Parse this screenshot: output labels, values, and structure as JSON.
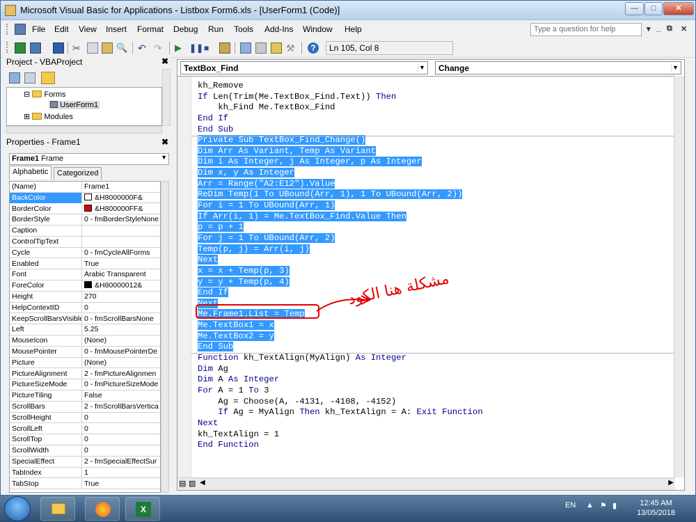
{
  "window": {
    "title": "Microsoft Visual Basic for Applications - Listbox Form6.xls - [UserForm1 (Code)]"
  },
  "menu": {
    "items": [
      "File",
      "Edit",
      "View",
      "Insert",
      "Format",
      "Debug",
      "Run",
      "Tools",
      "Add-Ins",
      "Window",
      "Help"
    ],
    "help_placeholder": "Type a question for help"
  },
  "toolbar": {
    "position": "Ln 105, Col 8"
  },
  "project": {
    "title": "Project - VBAProject",
    "tree": [
      "Forms",
      "UserForm1",
      "Modules"
    ]
  },
  "properties": {
    "title": "Properties - Frame1",
    "object": "Frame1",
    "object_type": "Frame",
    "tabs": [
      "Alphabetic",
      "Categorized"
    ],
    "rows": [
      {
        "name": "(Name)",
        "value": "Frame1"
      },
      {
        "name": "BackColor",
        "value": "&H8000000F&",
        "swatch": "#ffffff"
      },
      {
        "name": "BorderColor",
        "value": "&H800000FF&",
        "swatch": "#e00000"
      },
      {
        "name": "BorderStyle",
        "value": "0 - fmBorderStyleNone"
      },
      {
        "name": "Caption",
        "value": ""
      },
      {
        "name": "ControlTipText",
        "value": ""
      },
      {
        "name": "Cycle",
        "value": "0 - fmCycleAllForms"
      },
      {
        "name": "Enabled",
        "value": "True"
      },
      {
        "name": "Font",
        "value": "Arabic Transparent"
      },
      {
        "name": "ForeColor",
        "value": "&H80000012&",
        "swatch": "#000000"
      },
      {
        "name": "Height",
        "value": "270"
      },
      {
        "name": "HelpContextID",
        "value": "0"
      },
      {
        "name": "KeepScrollBarsVisible",
        "value": "0 - fmScrollBarsNone"
      },
      {
        "name": "Left",
        "value": "5.25"
      },
      {
        "name": "MouseIcon",
        "value": "(None)"
      },
      {
        "name": "MousePointer",
        "value": "0 - fmMousePointerDe"
      },
      {
        "name": "Picture",
        "value": "(None)"
      },
      {
        "name": "PictureAlignment",
        "value": "2 - fmPictureAlignmen"
      },
      {
        "name": "PictureSizeMode",
        "value": "0 - fmPictureSizeMode"
      },
      {
        "name": "PictureTiling",
        "value": "False"
      },
      {
        "name": "ScrollBars",
        "value": "2 - fmScrollBarsVertica"
      },
      {
        "name": "ScrollHeight",
        "value": "0"
      },
      {
        "name": "ScrollLeft",
        "value": "0"
      },
      {
        "name": "ScrollTop",
        "value": "0"
      },
      {
        "name": "ScrollWidth",
        "value": "0"
      },
      {
        "name": "SpecialEffect",
        "value": "2 - fmSpecialEffectSur"
      },
      {
        "name": "TabIndex",
        "value": "1"
      },
      {
        "name": "TabStop",
        "value": "True"
      }
    ]
  },
  "code": {
    "object_combo": "TextBox_Find",
    "proc_combo": "Change",
    "lines": [
      {
        "t": "kh_Remove",
        "hl": false
      },
      {
        "t": "If Len(Trim(Me.TextBox_Find.Text)) Then",
        "hl": false
      },
      {
        "t": "    kh_Find Me.TextBox_Find",
        "hl": false
      },
      {
        "t": "End If",
        "hl": false
      },
      {
        "t": "End Sub",
        "hl": false
      },
      {
        "t": "Private Sub TextBox_Find_Change()",
        "hl": true
      },
      {
        "t": "Dim Arr As Variant, Temp As Variant",
        "hl": true
      },
      {
        "t": "Dim i As Integer, j As Integer, p As Integer",
        "hl": true
      },
      {
        "t": "Dim x, y As Integer",
        "hl": true
      },
      {
        "t": "Arr = Range(\"A2:E12\").Value",
        "hl": true
      },
      {
        "t": "ReDim Temp(1 To UBound(Arr, 1), 1 To UBound(Arr, 2))",
        "hl": true
      },
      {
        "t": "For i = 1 To UBound(Arr, 1)",
        "hl": true
      },
      {
        "t": "If Arr(i, 1) = Me.TextBox_Find.Value Then",
        "hl": true
      },
      {
        "t": "p = p + 1",
        "hl": true
      },
      {
        "t": "For j = 1 To UBound(Arr, 2)",
        "hl": true
      },
      {
        "t": "Temp(p, j) = Arr(i, j)",
        "hl": true
      },
      {
        "t": "Next",
        "hl": true
      },
      {
        "t": "x = x + Temp(p, 3)",
        "hl": true
      },
      {
        "t": "y = y + Temp(p, 4)",
        "hl": true
      },
      {
        "t": "End If",
        "hl": true
      },
      {
        "t": "Next",
        "hl": true
      },
      {
        "t": "Me.Frame1.List = Temp",
        "hl": true
      },
      {
        "t": "Me.TextBox1 = x",
        "hl": true
      },
      {
        "t": "Me.TextBox2 = y",
        "hl": true
      },
      {
        "t": "End Sub",
        "hl": true
      },
      {
        "t": "Function kh_TextAlign(MyAlign) As Integer",
        "hl": false
      },
      {
        "t": "Dim Ag",
        "hl": false
      },
      {
        "t": "Dim A As Integer",
        "hl": false
      },
      {
        "t": "For A = 1 To 3",
        "hl": false
      },
      {
        "t": "    Ag = Choose(A, -4131, -4108, -4152)",
        "hl": false
      },
      {
        "t": "    If Ag = MyAlign Then kh_TextAlign = A: Exit Function",
        "hl": false
      },
      {
        "t": "Next",
        "hl": false
      },
      {
        "t": "kh_TextAlign = 1",
        "hl": false
      },
      {
        "t": "End Function",
        "hl": false
      }
    ],
    "annotation": "مشكلة هنا الكود"
  },
  "taskbar": {
    "lang": "EN",
    "time": "12:45 AM",
    "date": "13/05/2018"
  }
}
